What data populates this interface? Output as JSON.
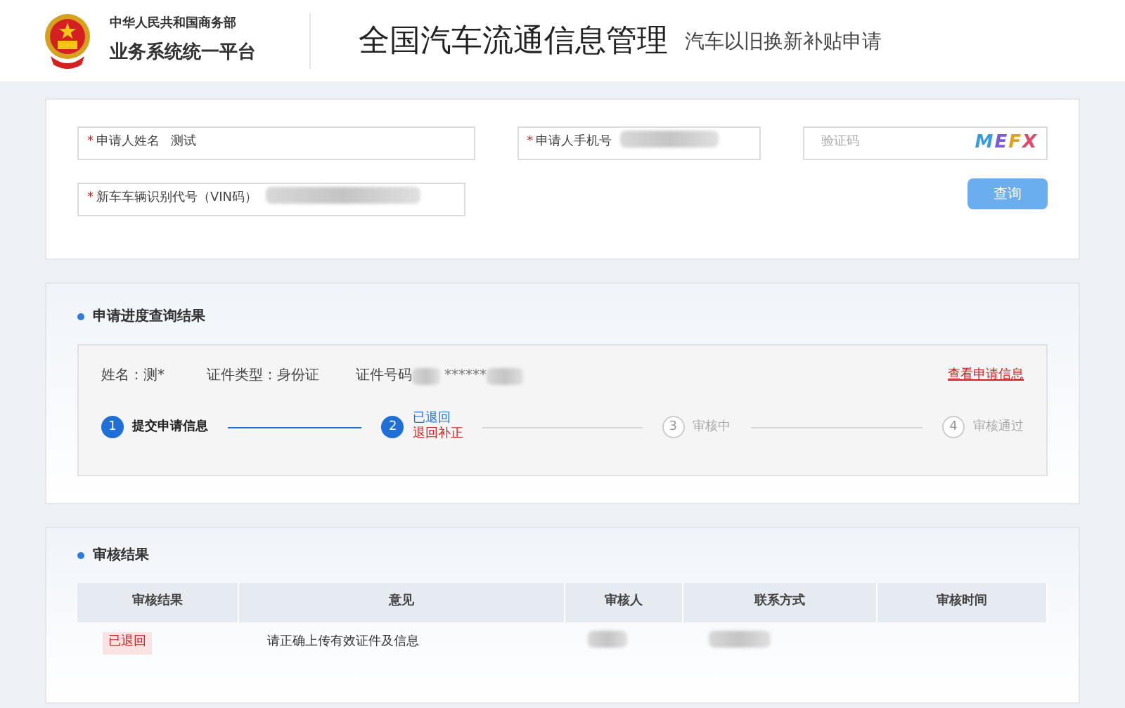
{
  "header": {
    "org_top": "中华人民共和国商务部",
    "org_bottom": "业务系统统一平台",
    "title": "全国汽车流通信息管理",
    "subtitle": "汽车以旧换新补贴申请"
  },
  "query_form": {
    "fields": [
      {
        "kind": "text",
        "required_mark": "*",
        "label": "申请人姓名",
        "value": "测试",
        "blurred": false
      },
      {
        "kind": "text",
        "required_mark": "*",
        "label": "申请人手机号",
        "blurred": true
      },
      {
        "kind": "captcha",
        "placeholder": "验证码",
        "captcha": "MEFX"
      },
      {
        "kind": "text",
        "required_mark": "*",
        "label": "新车车辆识别代号（VIN码）",
        "blurred": true
      }
    ],
    "button": "查询"
  },
  "progress": {
    "title": "申请进度查询结果",
    "name": "姓名：测*",
    "id_type": "证件类型：身份证",
    "id_label": "证件号码",
    "id_value": "******",
    "link": "查看申请信息",
    "steps": [
      {
        "number": "1",
        "completed": true,
        "current": false,
        "label": "提交申请信息"
      },
      {
        "number": "2",
        "completed": true,
        "current": true,
        "label": "已退回",
        "note": "退回补正"
      },
      {
        "number": "3",
        "completed": false,
        "current": false,
        "label": "审核中"
      },
      {
        "number": "4",
        "completed": false,
        "current": false,
        "label": "审核通过"
      }
    ]
  },
  "review": {
    "title": "审核结果",
    "columns": [
      "审核结果",
      "意见",
      "审核人",
      "联系方式",
      "审核时间"
    ],
    "rows": [
      {
        "result": "已退回",
        "opinion": "请正确上传有效证件及信息"
      }
    ]
  }
}
